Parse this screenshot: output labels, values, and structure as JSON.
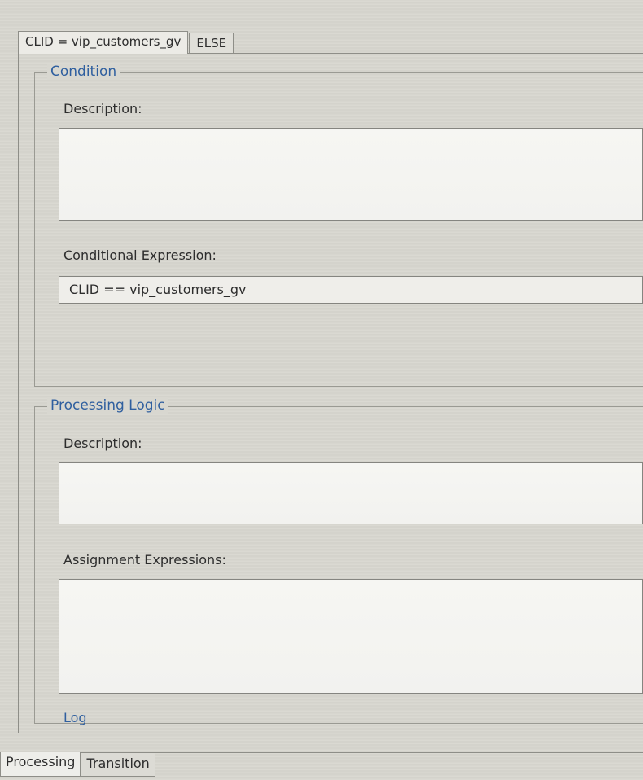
{
  "editor": {
    "tabs": [
      {
        "label": "CLID = vip_customers_gv",
        "active": true
      },
      {
        "label": "ELSE",
        "active": false
      }
    ],
    "condition": {
      "title": "Condition",
      "description_label": "Description:",
      "description_value": "",
      "conditional_expression_label": "Conditional Expression:",
      "conditional_expression_value": "CLID == vip_customers_gv"
    },
    "processing_logic": {
      "title": "Processing Logic",
      "description_label": "Description:",
      "description_value": "",
      "assignment_expressions_label": "Assignment Expressions:",
      "assignment_expressions_value": "",
      "log_label": "Log"
    }
  },
  "bottom_tabs": [
    {
      "label": "Processing",
      "active": true
    },
    {
      "label": "Transition",
      "active": false
    }
  ]
}
